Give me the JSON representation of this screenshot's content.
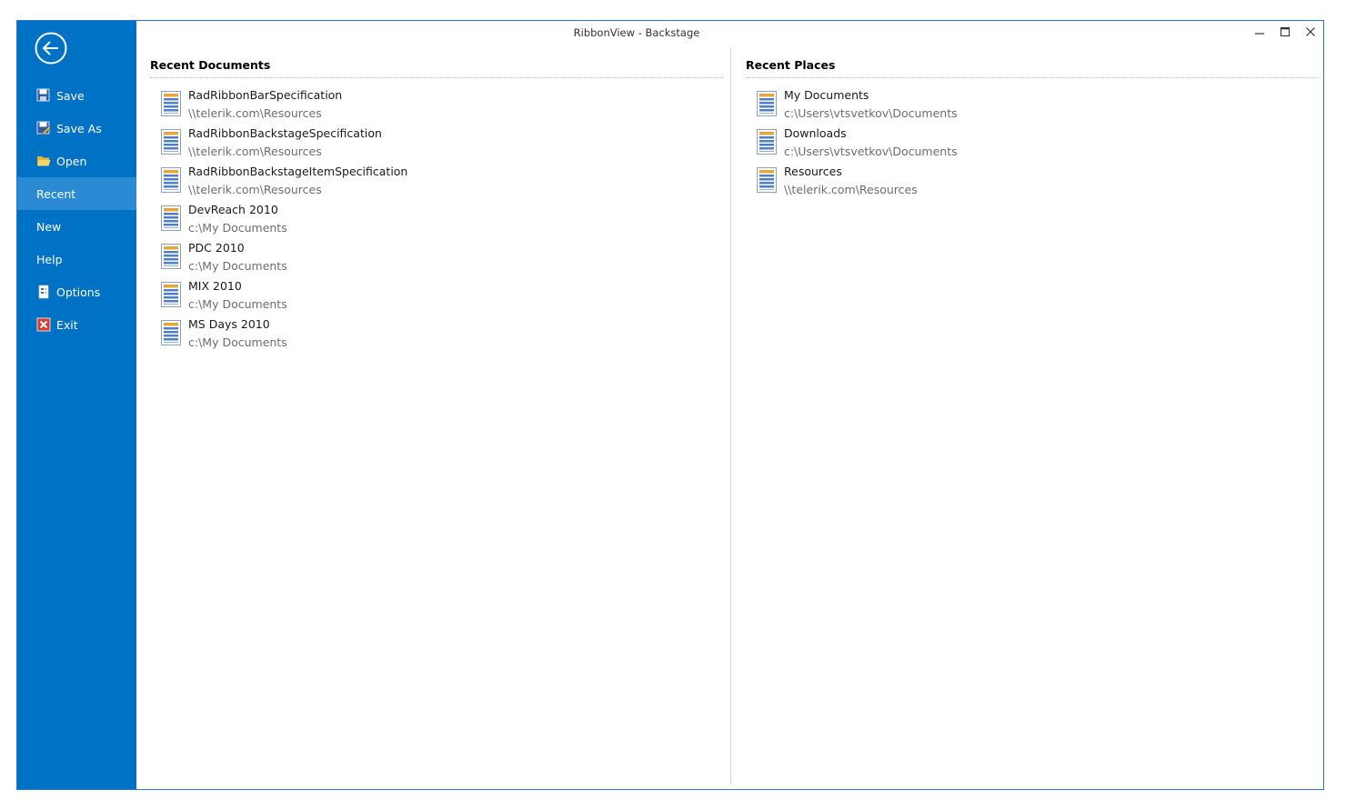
{
  "window": {
    "title": "RibbonView - Backstage"
  },
  "colors": {
    "sidebar_bg": "#0072c6",
    "sidebar_selected_bg": "#2a8ad4",
    "window_border": "#2b78c8"
  },
  "sidebar": {
    "back_icon": "arrow-left-circle-icon",
    "items": [
      {
        "label": "Save",
        "icon": "floppy-disk-icon"
      },
      {
        "label": "Save As",
        "icon": "save-as-icon"
      },
      {
        "label": "Open",
        "icon": "folder-open-icon"
      },
      {
        "label": "Recent",
        "icon": "",
        "selected": true
      },
      {
        "label": "New",
        "icon": ""
      },
      {
        "label": "Help",
        "icon": ""
      },
      {
        "label": "Options",
        "icon": "options-document-icon"
      },
      {
        "label": "Exit",
        "icon": "exit-x-icon"
      }
    ]
  },
  "recent_documents": {
    "title": "Recent Documents",
    "items": [
      {
        "name": "RadRibbonBarSpecification",
        "path": "\\\\telerik.com\\Resources"
      },
      {
        "name": "RadRibbonBackstageSpecification",
        "path": "\\\\telerik.com\\Resources"
      },
      {
        "name": "RadRibbonBackstageItemSpecification",
        "path": "\\\\telerik.com\\Resources"
      },
      {
        "name": "DevReach 2010",
        "path": "c:\\My Documents"
      },
      {
        "name": "PDC 2010",
        "path": "c:\\My Documents"
      },
      {
        "name": "MIX 2010",
        "path": "c:\\My Documents"
      },
      {
        "name": "MS Days 2010",
        "path": "c:\\My Documents"
      }
    ]
  },
  "recent_places": {
    "title": "Recent Places",
    "items": [
      {
        "name": "My Documents",
        "path": "c:\\Users\\vtsvetkov\\Documents"
      },
      {
        "name": "Downloads",
        "path": "c:\\Users\\vtsvetkov\\Documents"
      },
      {
        "name": "Resources",
        "path": "\\\\telerik.com\\Resources"
      }
    ]
  }
}
